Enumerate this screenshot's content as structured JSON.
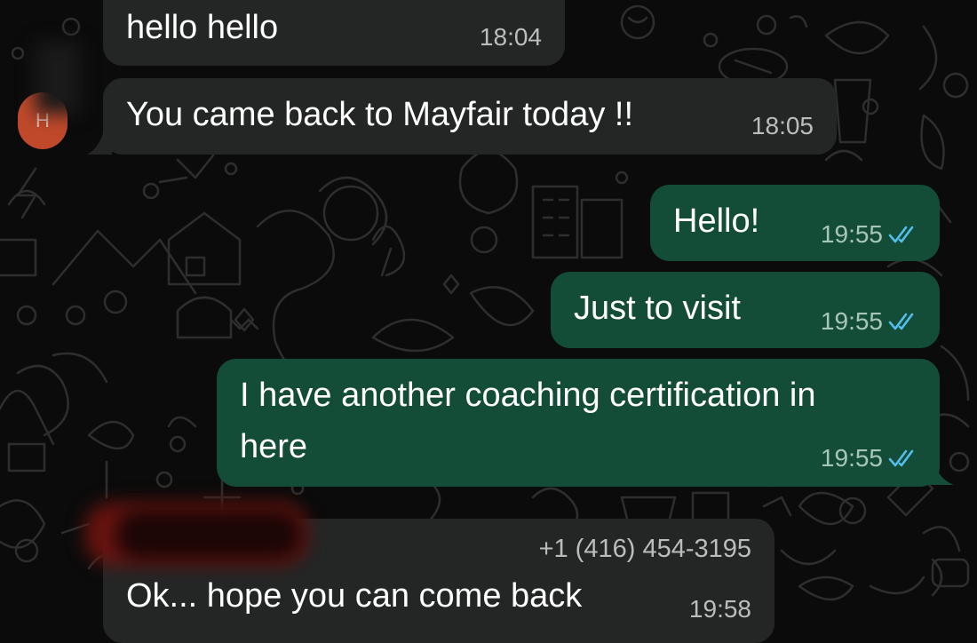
{
  "chat": {
    "messages": [
      {
        "id": 1,
        "direction": "incoming",
        "text": "hello hello",
        "time": "18:04"
      },
      {
        "id": 2,
        "direction": "incoming",
        "text": "You came back to Mayfair today !!",
        "time": "18:05",
        "avatar_letter": "H"
      },
      {
        "id": 3,
        "direction": "outgoing",
        "text": "Hello!",
        "time": "19:55",
        "status": "read"
      },
      {
        "id": 4,
        "direction": "outgoing",
        "text": "Just to visit",
        "time": "19:55",
        "status": "read"
      },
      {
        "id": 5,
        "direction": "outgoing",
        "text_line1": "I have another coaching certification in",
        "text_line2": "here",
        "time": "19:55",
        "status": "read"
      },
      {
        "id": 6,
        "direction": "incoming",
        "sender": "+1 (416) 454-3195",
        "text": "Ok... hope you can come back",
        "time": "19:58"
      }
    ]
  },
  "colors": {
    "background": "#0b0b0b",
    "incoming_bubble": "#242626",
    "outgoing_bubble": "#144d37",
    "read_ticks": "#53bdeb",
    "avatar": "#c0492b"
  },
  "icons": {
    "read_receipt": "double-check-icon",
    "wallpaper": "doodle-pattern"
  }
}
